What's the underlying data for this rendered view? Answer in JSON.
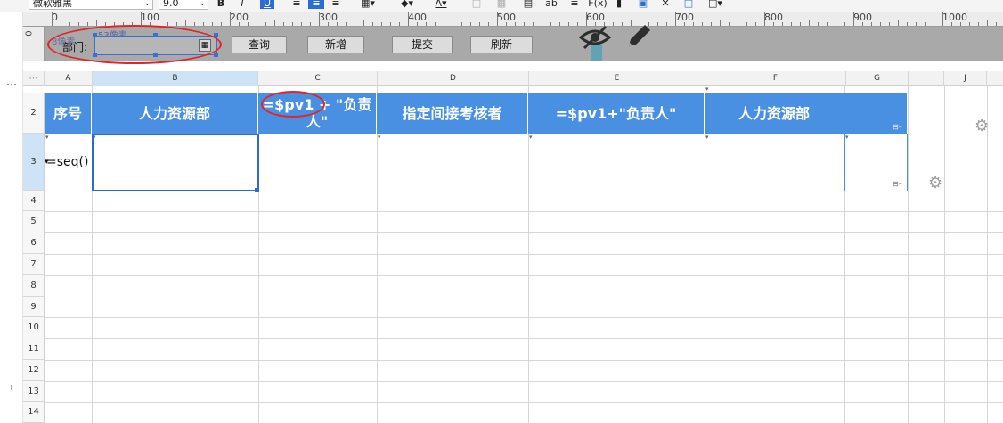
{
  "toolbar": {
    "font_name": "微软雅黑",
    "font_size": "9.0",
    "bold": "B",
    "italic": "I",
    "underline": "U",
    "strike_label": "ab",
    "formula_label": "F(x)",
    "text_color_label": "A"
  },
  "ruler": {
    "h_labels": [
      "0",
      "100",
      "200",
      "300",
      "400",
      "500",
      "600",
      "700",
      "800",
      "900",
      "1000"
    ],
    "v_label": "0"
  },
  "form": {
    "dept_label": "部门:",
    "dept_hint_top": "53像素",
    "dept_hint_left": "8像素",
    "query_button": "查询",
    "add_button": "新增",
    "submit_button": "提交",
    "refresh_button": "刷新"
  },
  "grid": {
    "columns": [
      "A",
      "B",
      "C",
      "D",
      "E",
      "F",
      "G",
      "I",
      "J"
    ],
    "rows": [
      "2",
      "3",
      "4",
      "5",
      "6",
      "7",
      "8",
      "9",
      "10",
      "11",
      "12",
      "13",
      "14"
    ],
    "header_cells": {
      "A": "序号",
      "B": "人力资源部",
      "C": "=$pv1 + \"负责人\"",
      "D": "指定间接考核者",
      "E": "=$pv1+\"负责人\"",
      "F": "人力资源部"
    },
    "formula_cell_A3": "=seq()"
  },
  "colors": {
    "header_blue": "#4a90e2",
    "selection_blue": "#2b6cd4",
    "annotation_red": "#e0262b",
    "design_gray": "#a9a9a9"
  },
  "icons": [
    "hide-icon",
    "edit-pencil-icon",
    "settings-gear-icon",
    "cell-expand-icon"
  ]
}
